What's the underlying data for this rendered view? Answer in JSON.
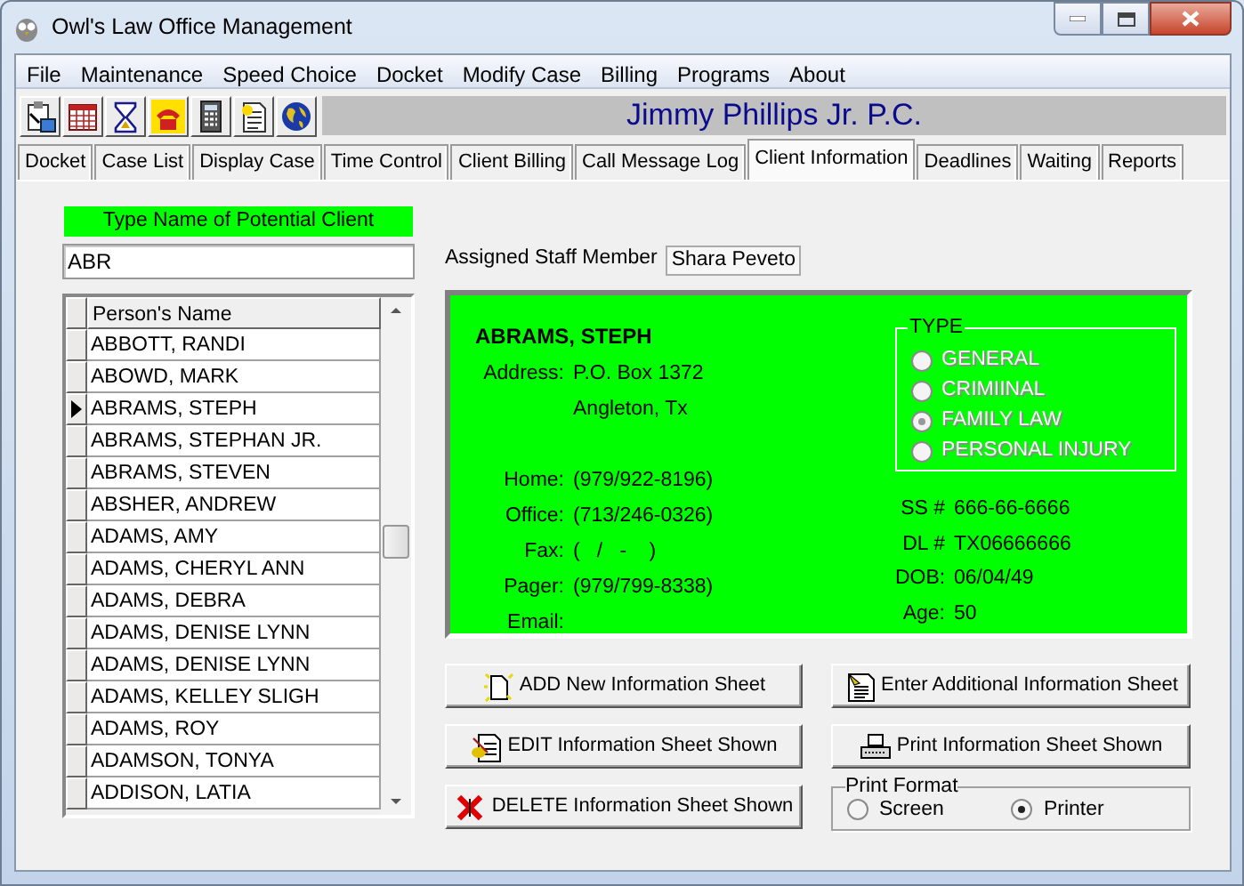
{
  "window": {
    "title": "Owl's Law Office Management"
  },
  "menu": [
    "File",
    "Maintenance",
    "Speed Choice",
    "Docket",
    "Modify Case",
    "Billing",
    "Programs",
    "About"
  ],
  "toolbar": {
    "icons": [
      {
        "kind": "clipboard"
      },
      {
        "kind": "calendar"
      },
      {
        "kind": "hourglass"
      },
      {
        "kind": "telephone"
      },
      {
        "kind": "calculator"
      },
      {
        "kind": "document"
      },
      {
        "kind": "globe"
      }
    ],
    "firm_name": "Jimmy Phillips Jr. P.C."
  },
  "tabs": [
    {
      "label": "Docket",
      "selected": false
    },
    {
      "label": "Case List",
      "selected": false
    },
    {
      "label": "Display Case",
      "selected": false
    },
    {
      "label": "Time Control",
      "selected": false
    },
    {
      "label": "Client Billing",
      "selected": false
    },
    {
      "label": "Call Message Log",
      "selected": false
    },
    {
      "label": "Client Information",
      "selected": true
    },
    {
      "label": "Deadlines",
      "selected": false
    },
    {
      "label": "Waiting",
      "selected": false
    },
    {
      "label": "Reports",
      "selected": false
    }
  ],
  "search": {
    "label": "Type Name of Potential Client",
    "value": "ABR"
  },
  "grid": {
    "columns": [
      "Person's Name"
    ],
    "rows": [
      {
        "name": "ABBOTT, RANDI",
        "selected": false
      },
      {
        "name": "ABOWD, MARK",
        "selected": false
      },
      {
        "name": "ABRAMS, STEPH",
        "selected": true
      },
      {
        "name": "ABRAMS, STEPHAN JR.",
        "selected": false
      },
      {
        "name": "ABRAMS, STEVEN",
        "selected": false
      },
      {
        "name": "ABSHER, ANDREW",
        "selected": false
      },
      {
        "name": "ADAMS, AMY",
        "selected": false
      },
      {
        "name": "ADAMS, CHERYL ANN",
        "selected": false
      },
      {
        "name": "ADAMS, DEBRA",
        "selected": false
      },
      {
        "name": "ADAMS, DENISE LYNN",
        "selected": false
      },
      {
        "name": "ADAMS, DENISE LYNN",
        "selected": false
      },
      {
        "name": "ADAMS, KELLEY SLIGH",
        "selected": false
      },
      {
        "name": "ADAMS, ROY",
        "selected": false
      },
      {
        "name": "ADAMSON, TONYA",
        "selected": false
      },
      {
        "name": "ADDISON, LATIA",
        "selected": false
      }
    ]
  },
  "assigned_staff": {
    "label": "Assigned Staff Member",
    "value": "Shara Peveto"
  },
  "client": {
    "name": "ABRAMS, STEPH",
    "fields_left": [
      {
        "label": "Address:",
        "lines": [
          "P.O. Box 1372",
          "Angleton, Tx"
        ]
      },
      {
        "label": "Home:",
        "lines": [
          "(979/922-8196)"
        ]
      },
      {
        "label": "Office:",
        "lines": [
          "(713/246-0326)"
        ]
      },
      {
        "label": "Fax:",
        "lines": [
          "(   /   -    )"
        ]
      },
      {
        "label": "Pager:",
        "lines": [
          "(979/799-8338)"
        ]
      },
      {
        "label": "Email:"
      }
    ],
    "type_group": {
      "title": "TYPE",
      "disabled": true,
      "options": [
        {
          "label": "GENERAL",
          "selected": false
        },
        {
          "label": "CRIMIINAL",
          "selected": false
        },
        {
          "label": "FAMILY LAW",
          "selected": true
        },
        {
          "label": "PERSONAL INJURY",
          "selected": false
        }
      ]
    },
    "fields_right": [
      {
        "label": "SS #",
        "value": "666-66-6666"
      },
      {
        "label": "DL #",
        "value": "TX06666666"
      },
      {
        "label": "DOB:",
        "value": "06/04/49"
      },
      {
        "label": "Age:",
        "value": "50"
      }
    ]
  },
  "buttons": [
    {
      "label": "ADD  New Information Sheet",
      "kind": "new"
    },
    {
      "label": "Enter Additional Information Sheet",
      "kind": "form"
    },
    {
      "label": "EDIT Information Sheet Shown",
      "kind": "edit"
    },
    {
      "label": "Print Information Sheet Shown",
      "kind": "print"
    },
    {
      "label": "DELETE Information Sheet Shown",
      "kind": "delete"
    }
  ],
  "print_format": {
    "title": "Print Format",
    "options": [
      {
        "label": "Screen",
        "selected": false
      },
      {
        "label": "Printer",
        "selected": true
      }
    ]
  }
}
